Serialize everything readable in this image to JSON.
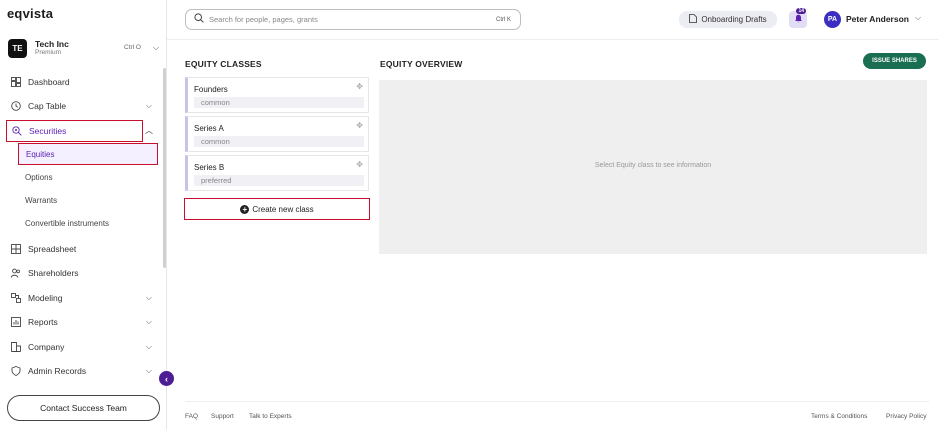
{
  "app": {
    "logo": "eqvista"
  },
  "company": {
    "initials": "TE",
    "name": "Tech Inc",
    "plan": "Premium",
    "shortcut": "Ctrl O"
  },
  "sidebar": {
    "items": [
      {
        "label": "Dashboard",
        "icon": "dashboard-icon"
      },
      {
        "label": "Cap Table",
        "icon": "clock-icon"
      },
      {
        "label": "Securities",
        "icon": "securities-icon"
      },
      {
        "label": "Spreadsheet",
        "icon": "grid-icon"
      },
      {
        "label": "Shareholders",
        "icon": "users-icon"
      },
      {
        "label": "Modeling",
        "icon": "modeling-icon"
      },
      {
        "label": "Reports",
        "icon": "chart-icon"
      },
      {
        "label": "Company",
        "icon": "company-icon"
      },
      {
        "label": "Admin Records",
        "icon": "shield-icon"
      }
    ],
    "securities_sub": [
      "Equities",
      "Options",
      "Warrants",
      "Convertible instruments"
    ],
    "contact_label": "Contact Success Team"
  },
  "topbar": {
    "search_placeholder": "Search for people, pages, grants",
    "search_shortcut": "Ctrl K",
    "drafts_label": "Onboarding Drafts",
    "notif_count": "14",
    "user_initials": "PA",
    "user_name": "Peter Anderson"
  },
  "classes": {
    "title": "EQUITY CLASSES",
    "items": [
      {
        "name": "Founders",
        "type": "common"
      },
      {
        "name": "Series A",
        "type": "common"
      },
      {
        "name": "Series B",
        "type": "preferred"
      }
    ],
    "create_label": "Create new class"
  },
  "overview": {
    "title": "EQUITY OVERVIEW",
    "issue_label": "ISSUE SHARES",
    "empty_message": "Select Equity class to see information"
  },
  "footer": {
    "faq": "FAQ",
    "support": "Support",
    "experts": "Talk to Experts",
    "terms": "Terms & Conditions",
    "privacy": "Privacy Policy"
  },
  "colors": {
    "accent": "#5b21b6",
    "brand_green": "#1a6e52",
    "highlight": "#c8102e"
  }
}
